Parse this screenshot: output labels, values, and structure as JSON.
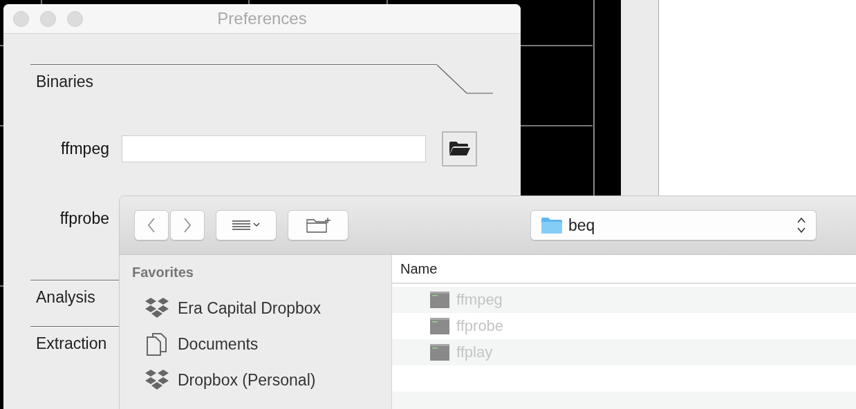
{
  "preferences_window": {
    "title": "Preferences",
    "sections": [
      {
        "label": "Binaries",
        "expanded": true,
        "fields": [
          {
            "label": "ffmpeg"
          },
          {
            "label": "ffprobe"
          }
        ]
      },
      {
        "label": "Analysis",
        "expanded": false
      },
      {
        "label": "Extraction",
        "expanded": false
      }
    ]
  },
  "open_dialog": {
    "location": "beq",
    "sidebar": {
      "heading": "Favorites",
      "items": [
        {
          "label": "Era Capital Dropbox",
          "kind": "dropbox"
        },
        {
          "label": "Documents",
          "kind": "documents"
        },
        {
          "label": "Dropbox (Personal)",
          "kind": "dropbox"
        }
      ]
    },
    "columns": [
      "Name"
    ],
    "files": [
      {
        "name": "ffmpeg",
        "disabled": true
      },
      {
        "name": "ffprobe",
        "disabled": true
      },
      {
        "name": "ffplay",
        "disabled": true
      }
    ]
  }
}
